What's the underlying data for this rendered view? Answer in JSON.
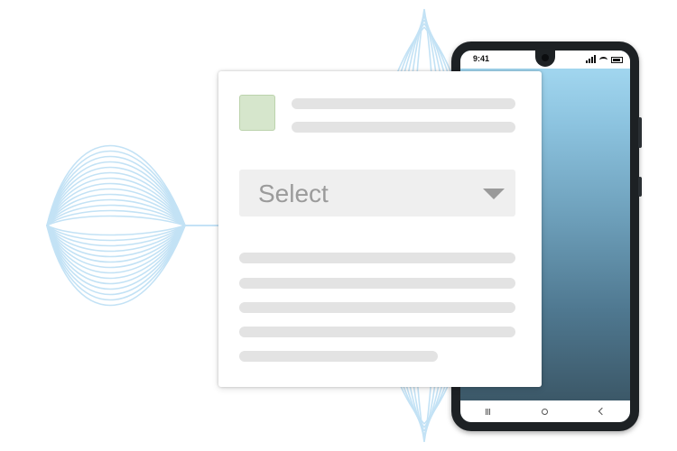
{
  "phone": {
    "status_time": "9:41"
  },
  "form": {
    "select_label": "Select",
    "select_icon": "chevron-down-icon"
  },
  "colors": {
    "wave": "#bfe0f4",
    "avatar_fill": "#d6e6cc",
    "placeholder_bar": "#e3e3e3",
    "select_bg": "#efefef",
    "select_text": "#9b9b9b"
  }
}
